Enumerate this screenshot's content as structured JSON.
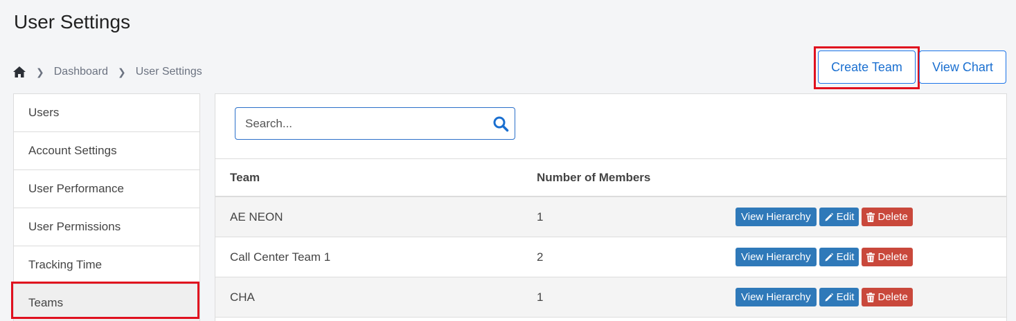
{
  "page": {
    "title": "User Settings"
  },
  "breadcrumb": {
    "icon": "home-icon",
    "items": [
      "Dashboard",
      "User Settings"
    ]
  },
  "actions": {
    "create_team": "Create Team",
    "view_chart": "View Chart"
  },
  "sidebar": {
    "items": [
      {
        "label": "Users"
      },
      {
        "label": "Account Settings"
      },
      {
        "label": "User Performance"
      },
      {
        "label": "User Permissions"
      },
      {
        "label": "Tracking Time"
      },
      {
        "label": "Teams",
        "active": true
      }
    ]
  },
  "search": {
    "placeholder": "Search...",
    "value": ""
  },
  "table": {
    "headers": {
      "team": "Team",
      "members": "Number of Members"
    },
    "row_actions": {
      "view": "View Hierarchy",
      "edit": "Edit",
      "delete": "Delete"
    },
    "rows": [
      {
        "team": "AE NEON",
        "members": "1"
      },
      {
        "team": "Call Center Team 1",
        "members": "2"
      },
      {
        "team": "CHA",
        "members": "1"
      }
    ]
  },
  "colors": {
    "primary": "#1a73e8",
    "action_blue": "#2f79b9",
    "danger": "#c9483b",
    "highlight": "#e0101e"
  }
}
